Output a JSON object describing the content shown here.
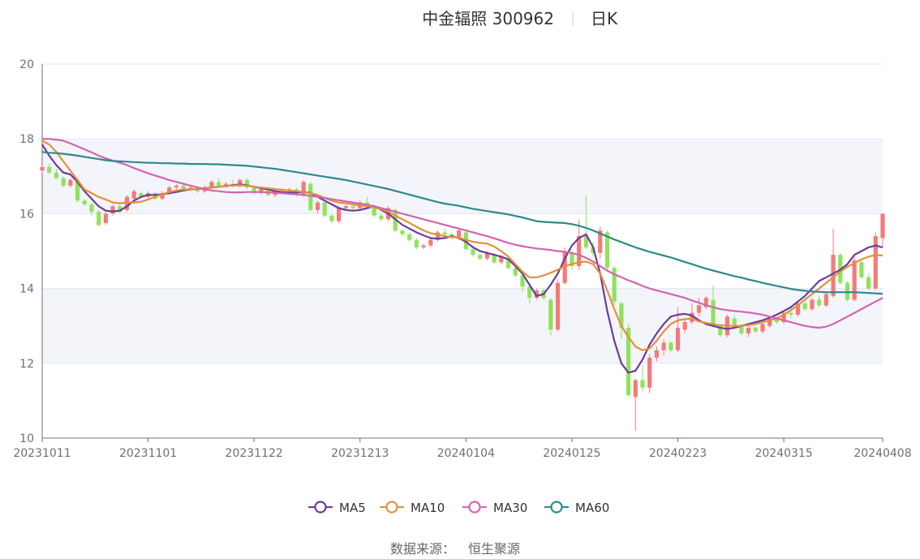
{
  "header": {
    "title": "中金辐照 300962",
    "period": "日K"
  },
  "footer": {
    "source_label": "数据来源：",
    "source_name": "恒生聚源"
  },
  "colors": {
    "up": "#f47a7a",
    "down": "#8fe35c",
    "band": "#f3f5fb",
    "grid": "#e0e6f1",
    "MA5": "#6a3d9a",
    "MA10": "#e3913a",
    "MA30": "#d563b3",
    "MA60": "#2f8a8a"
  },
  "chart_data": {
    "type": "candlestick",
    "x_tick_labels": [
      "20231011",
      "20231101",
      "20231122",
      "20231213",
      "20240104",
      "20240125",
      "20240223",
      "20240315",
      "20240408"
    ],
    "x_tick_indices": [
      0,
      15,
      30,
      45,
      60,
      75,
      90,
      105,
      119
    ],
    "ylim": [
      10,
      20
    ],
    "y_ticks": [
      10,
      12,
      14,
      16,
      18,
      20
    ],
    "legend": [
      "MA5",
      "MA10",
      "MA30",
      "MA60"
    ],
    "series": [
      {
        "name": "MA5",
        "values": [
          17.85,
          17.55,
          17.3,
          17.1,
          17.05,
          16.85,
          16.6,
          16.4,
          16.2,
          16.08,
          16.06,
          16.08,
          16.2,
          16.35,
          16.45,
          16.5,
          16.5,
          16.52,
          16.55,
          16.58,
          16.62,
          16.65,
          16.66,
          16.68,
          16.7,
          16.72,
          16.74,
          16.76,
          16.78,
          16.76,
          16.72,
          16.68,
          16.65,
          16.6,
          16.58,
          16.56,
          16.57,
          16.58,
          16.56,
          16.45,
          16.35,
          16.25,
          16.15,
          16.1,
          16.08,
          16.1,
          16.15,
          16.2,
          16.1,
          16.0,
          15.85,
          15.7,
          15.6,
          15.5,
          15.42,
          15.35,
          15.33,
          15.35,
          15.4,
          15.35,
          15.25,
          15.1,
          15.0,
          14.95,
          14.9,
          14.85,
          14.78,
          14.6,
          14.4,
          14.1,
          13.8,
          13.85,
          14.1,
          14.4,
          14.8,
          15.15,
          15.35,
          15.45,
          15.1,
          14.4,
          13.4,
          12.6,
          12.0,
          11.75,
          11.8,
          12.1,
          12.5,
          12.8,
          13.05,
          13.25,
          13.3,
          13.32,
          13.28,
          13.15,
          13.05,
          13.0,
          12.95,
          12.92,
          12.95,
          13.0,
          13.05,
          13.1,
          13.15,
          13.22,
          13.3,
          13.4,
          13.5,
          13.65,
          13.8,
          14.0,
          14.2,
          14.3,
          14.4,
          14.5,
          14.65,
          14.9,
          15.0,
          15.1,
          15.15,
          15.1
        ]
      },
      {
        "name": "MA10",
        "values": [
          17.95,
          17.85,
          17.65,
          17.4,
          17.15,
          16.9,
          16.65,
          16.55,
          16.45,
          16.38,
          16.3,
          16.28,
          16.3,
          16.3,
          16.32,
          16.38,
          16.45,
          16.52,
          16.58,
          16.62,
          16.65,
          16.65,
          16.66,
          16.67,
          16.7,
          16.72,
          16.74,
          16.75,
          16.76,
          16.75,
          16.72,
          16.7,
          16.68,
          16.66,
          16.64,
          16.62,
          16.6,
          16.58,
          16.55,
          16.5,
          16.42,
          16.35,
          16.3,
          16.28,
          16.25,
          16.22,
          16.2,
          16.17,
          16.12,
          16.05,
          15.95,
          15.85,
          15.75,
          15.65,
          15.55,
          15.48,
          15.44,
          15.4,
          15.38,
          15.36,
          15.3,
          15.25,
          15.22,
          15.2,
          15.12,
          15.0,
          14.85,
          14.65,
          14.45,
          14.3,
          14.3,
          14.35,
          14.42,
          14.5,
          14.6,
          14.65,
          14.7,
          14.72,
          14.65,
          14.4,
          13.95,
          13.45,
          13.0,
          12.7,
          12.45,
          12.35,
          12.4,
          12.6,
          12.85,
          13.05,
          13.15,
          13.18,
          13.2,
          13.12,
          13.08,
          13.05,
          13.02,
          13.0,
          13.0,
          13.0,
          13.02,
          13.05,
          13.1,
          13.15,
          13.2,
          13.3,
          13.42,
          13.55,
          13.7,
          13.85,
          14.0,
          14.15,
          14.3,
          14.45,
          14.58,
          14.68,
          14.78,
          14.85,
          14.9,
          14.88
        ]
      },
      {
        "name": "MA30",
        "values": [
          18.0,
          18.0,
          17.98,
          17.95,
          17.88,
          17.8,
          17.72,
          17.64,
          17.55,
          17.48,
          17.42,
          17.36,
          17.3,
          17.22,
          17.15,
          17.08,
          17.02,
          16.96,
          16.9,
          16.85,
          16.8,
          16.75,
          16.7,
          16.66,
          16.62,
          16.6,
          16.58,
          16.57,
          16.57,
          16.58,
          16.58,
          16.58,
          16.57,
          16.56,
          16.55,
          16.53,
          16.52,
          16.5,
          16.48,
          16.45,
          16.42,
          16.39,
          16.36,
          16.33,
          16.3,
          16.27,
          16.24,
          16.2,
          16.15,
          16.1,
          16.05,
          16.0,
          15.95,
          15.9,
          15.85,
          15.8,
          15.75,
          15.7,
          15.65,
          15.6,
          15.55,
          15.5,
          15.45,
          15.4,
          15.34,
          15.28,
          15.22,
          15.17,
          15.13,
          15.1,
          15.07,
          15.05,
          15.03,
          15.0,
          14.98,
          14.95,
          14.9,
          14.82,
          14.72,
          14.6,
          14.48,
          14.38,
          14.3,
          14.22,
          14.15,
          14.07,
          14.0,
          13.95,
          13.9,
          13.85,
          13.8,
          13.75,
          13.68,
          13.62,
          13.55,
          13.5,
          13.45,
          13.42,
          13.4,
          13.38,
          13.36,
          13.33,
          13.3,
          13.25,
          13.2,
          13.15,
          13.1,
          13.05,
          13.0,
          12.97,
          12.95,
          12.98,
          13.05,
          13.15,
          13.25,
          13.35,
          13.45,
          13.55,
          13.65,
          13.75
        ]
      },
      {
        "name": "MA60",
        "values": [
          17.65,
          17.63,
          17.62,
          17.6,
          17.58,
          17.55,
          17.52,
          17.49,
          17.46,
          17.43,
          17.41,
          17.4,
          17.39,
          17.38,
          17.37,
          17.36,
          17.36,
          17.35,
          17.35,
          17.34,
          17.34,
          17.33,
          17.33,
          17.33,
          17.32,
          17.32,
          17.31,
          17.3,
          17.29,
          17.28,
          17.26,
          17.24,
          17.22,
          17.2,
          17.17,
          17.14,
          17.11,
          17.08,
          17.05,
          17.02,
          16.99,
          16.96,
          16.93,
          16.9,
          16.86,
          16.82,
          16.78,
          16.74,
          16.7,
          16.66,
          16.61,
          16.56,
          16.51,
          16.46,
          16.41,
          16.36,
          16.31,
          16.27,
          16.24,
          16.21,
          16.17,
          16.13,
          16.1,
          16.07,
          16.04,
          16.01,
          15.98,
          15.94,
          15.9,
          15.85,
          15.8,
          15.78,
          15.77,
          15.76,
          15.75,
          15.72,
          15.68,
          15.62,
          15.55,
          15.47,
          15.39,
          15.31,
          15.24,
          15.17,
          15.1,
          15.04,
          14.98,
          14.93,
          14.88,
          14.83,
          14.77,
          14.71,
          14.65,
          14.59,
          14.53,
          14.48,
          14.43,
          14.38,
          14.33,
          14.29,
          14.24,
          14.2,
          14.15,
          14.11,
          14.07,
          14.03,
          13.99,
          13.96,
          13.94,
          13.92,
          13.91,
          13.9,
          13.9,
          13.9,
          13.9,
          13.9,
          13.89,
          13.88,
          13.87,
          13.86
        ]
      }
    ],
    "candles": [
      [
        17.15,
        17.25,
        17.3,
        17.1
      ],
      [
        17.25,
        17.1,
        17.35,
        17.05
      ],
      [
        17.1,
        16.95,
        17.2,
        16.9
      ],
      [
        16.95,
        16.75,
        17.0,
        16.7
      ],
      [
        16.75,
        16.9,
        16.95,
        16.7
      ],
      [
        16.9,
        16.35,
        16.95,
        16.3
      ],
      [
        16.35,
        16.25,
        16.4,
        16.2
      ],
      [
        16.25,
        16.05,
        16.3,
        15.95
      ],
      [
        16.05,
        15.7,
        16.1,
        15.65
      ],
      [
        15.75,
        16.0,
        16.05,
        15.7
      ],
      [
        16.0,
        16.2,
        16.25,
        15.95
      ],
      [
        16.2,
        16.05,
        16.3,
        16.0
      ],
      [
        16.1,
        16.45,
        16.5,
        16.05
      ],
      [
        16.4,
        16.6,
        16.65,
        16.35
      ],
      [
        16.55,
        16.45,
        16.6,
        16.4
      ],
      [
        16.45,
        16.55,
        16.6,
        16.4
      ],
      [
        16.55,
        16.4,
        16.6,
        16.35
      ],
      [
        16.4,
        16.55,
        16.6,
        16.35
      ],
      [
        16.55,
        16.7,
        16.75,
        16.5
      ],
      [
        16.7,
        16.75,
        16.8,
        16.65
      ],
      [
        16.75,
        16.65,
        16.8,
        16.6
      ],
      [
        16.65,
        16.7,
        16.75,
        16.6
      ],
      [
        16.7,
        16.6,
        16.75,
        16.55
      ],
      [
        16.6,
        16.7,
        16.75,
        16.55
      ],
      [
        16.7,
        16.85,
        16.9,
        16.65
      ],
      [
        16.85,
        16.75,
        16.95,
        16.7
      ],
      [
        16.75,
        16.8,
        16.85,
        16.7
      ],
      [
        16.8,
        16.75,
        16.9,
        16.7
      ],
      [
        16.75,
        16.9,
        16.95,
        16.7
      ],
      [
        16.9,
        16.7,
        16.95,
        16.65
      ],
      [
        16.7,
        16.55,
        16.75,
        16.5
      ],
      [
        16.55,
        16.65,
        16.7,
        16.5
      ],
      [
        16.65,
        16.5,
        16.7,
        16.45
      ],
      [
        16.5,
        16.6,
        16.65,
        16.45
      ],
      [
        16.6,
        16.55,
        16.65,
        16.5
      ],
      [
        16.55,
        16.65,
        16.7,
        16.5
      ],
      [
        16.65,
        16.5,
        16.7,
        16.45
      ],
      [
        16.5,
        16.85,
        16.9,
        16.45
      ],
      [
        16.8,
        16.1,
        16.85,
        16.05
      ],
      [
        16.1,
        16.3,
        16.35,
        16.0
      ],
      [
        16.3,
        15.95,
        16.35,
        15.9
      ],
      [
        15.95,
        15.8,
        16.0,
        15.75
      ],
      [
        15.8,
        16.15,
        16.2,
        15.75
      ],
      [
        16.15,
        16.2,
        16.25,
        16.1
      ],
      [
        16.2,
        16.15,
        16.3,
        16.1
      ],
      [
        16.15,
        16.3,
        16.35,
        16.1
      ],
      [
        16.3,
        16.2,
        16.45,
        16.15
      ],
      [
        16.2,
        15.95,
        16.25,
        15.9
      ],
      [
        15.95,
        15.85,
        16.0,
        15.8
      ],
      [
        15.85,
        16.15,
        16.2,
        15.8
      ],
      [
        16.1,
        15.55,
        16.15,
        15.5
      ],
      [
        15.55,
        15.45,
        15.6,
        15.4
      ],
      [
        15.45,
        15.3,
        15.5,
        15.25
      ],
      [
        15.3,
        15.1,
        15.35,
        15.05
      ],
      [
        15.1,
        15.15,
        15.2,
        15.05
      ],
      [
        15.15,
        15.3,
        15.35,
        15.1
      ],
      [
        15.3,
        15.5,
        15.55,
        15.25
      ],
      [
        15.5,
        15.45,
        15.6,
        15.4
      ],
      [
        15.45,
        15.35,
        15.5,
        15.3
      ],
      [
        15.35,
        15.55,
        15.6,
        15.3
      ],
      [
        15.5,
        15.05,
        15.55,
        15.0
      ],
      [
        15.05,
        14.9,
        15.1,
        14.85
      ],
      [
        14.9,
        14.8,
        14.95,
        14.75
      ],
      [
        14.8,
        14.95,
        15.0,
        14.75
      ],
      [
        14.9,
        14.7,
        14.95,
        14.65
      ],
      [
        14.7,
        14.85,
        14.9,
        14.65
      ],
      [
        14.8,
        14.55,
        14.85,
        14.5
      ],
      [
        14.55,
        14.35,
        14.6,
        14.3
      ],
      [
        14.35,
        14.05,
        14.4,
        13.9
      ],
      [
        14.05,
        13.75,
        14.1,
        13.6
      ],
      [
        13.75,
        13.95,
        14.0,
        13.7
      ],
      [
        13.95,
        13.75,
        14.0,
        13.7
      ],
      [
        13.7,
        12.9,
        13.75,
        12.75
      ],
      [
        12.9,
        14.15,
        14.25,
        12.85
      ],
      [
        14.15,
        15.0,
        15.1,
        14.1
      ],
      [
        14.95,
        14.6,
        15.05,
        14.5
      ],
      [
        14.6,
        15.4,
        15.85,
        14.5
      ],
      [
        15.4,
        15.1,
        16.5,
        15.05
      ],
      [
        15.1,
        14.95,
        15.25,
        14.85
      ],
      [
        14.95,
        15.55,
        15.65,
        14.8
      ],
      [
        15.5,
        14.55,
        15.55,
        14.45
      ],
      [
        14.55,
        13.65,
        14.6,
        13.55
      ],
      [
        13.6,
        12.95,
        13.65,
        12.65
      ],
      [
        12.95,
        11.15,
        13.05,
        11.1
      ],
      [
        11.1,
        11.55,
        11.6,
        10.2
      ],
      [
        11.55,
        11.35,
        11.95,
        11.25
      ],
      [
        11.35,
        12.15,
        12.25,
        11.2
      ],
      [
        12.15,
        12.35,
        12.45,
        12.05
      ],
      [
        12.35,
        12.55,
        12.65,
        12.2
      ],
      [
        12.55,
        12.35,
        12.6,
        12.3
      ],
      [
        12.35,
        12.95,
        13.5,
        12.3
      ],
      [
        12.9,
        13.1,
        13.2,
        12.8
      ],
      [
        13.1,
        13.35,
        13.6,
        13.05
      ],
      [
        13.35,
        13.55,
        13.75,
        13.25
      ],
      [
        13.5,
        13.75,
        13.8,
        13.45
      ],
      [
        13.7,
        13.0,
        14.1,
        12.95
      ],
      [
        13.0,
        12.75,
        13.05,
        12.7
      ],
      [
        12.75,
        13.25,
        13.3,
        12.7
      ],
      [
        13.2,
        13.0,
        13.3,
        12.95
      ],
      [
        13.0,
        12.8,
        13.05,
        12.75
      ],
      [
        12.8,
        12.95,
        13.0,
        12.7
      ],
      [
        12.95,
        12.85,
        13.0,
        12.8
      ],
      [
        12.85,
        13.05,
        13.15,
        12.8
      ],
      [
        13.0,
        13.2,
        13.25,
        12.95
      ],
      [
        13.2,
        13.1,
        13.25,
        13.05
      ],
      [
        13.1,
        13.35,
        13.4,
        13.05
      ],
      [
        13.35,
        13.3,
        13.5,
        13.2
      ],
      [
        13.3,
        13.6,
        13.65,
        13.25
      ],
      [
        13.6,
        13.45,
        13.7,
        13.4
      ],
      [
        13.45,
        13.7,
        13.75,
        13.4
      ],
      [
        13.7,
        13.55,
        13.8,
        13.5
      ],
      [
        13.55,
        13.85,
        13.9,
        13.5
      ],
      [
        13.8,
        14.9,
        15.6,
        13.75
      ],
      [
        14.9,
        14.15,
        14.95,
        14.1
      ],
      [
        14.15,
        13.7,
        14.2,
        13.65
      ],
      [
        13.7,
        14.75,
        14.85,
        13.65
      ],
      [
        14.7,
        14.3,
        14.8,
        14.25
      ],
      [
        14.3,
        14.0,
        14.4,
        13.95
      ],
      [
        14.0,
        15.4,
        15.5,
        13.95
      ],
      [
        15.35,
        16.0,
        16.0,
        15.1
      ]
    ]
  }
}
